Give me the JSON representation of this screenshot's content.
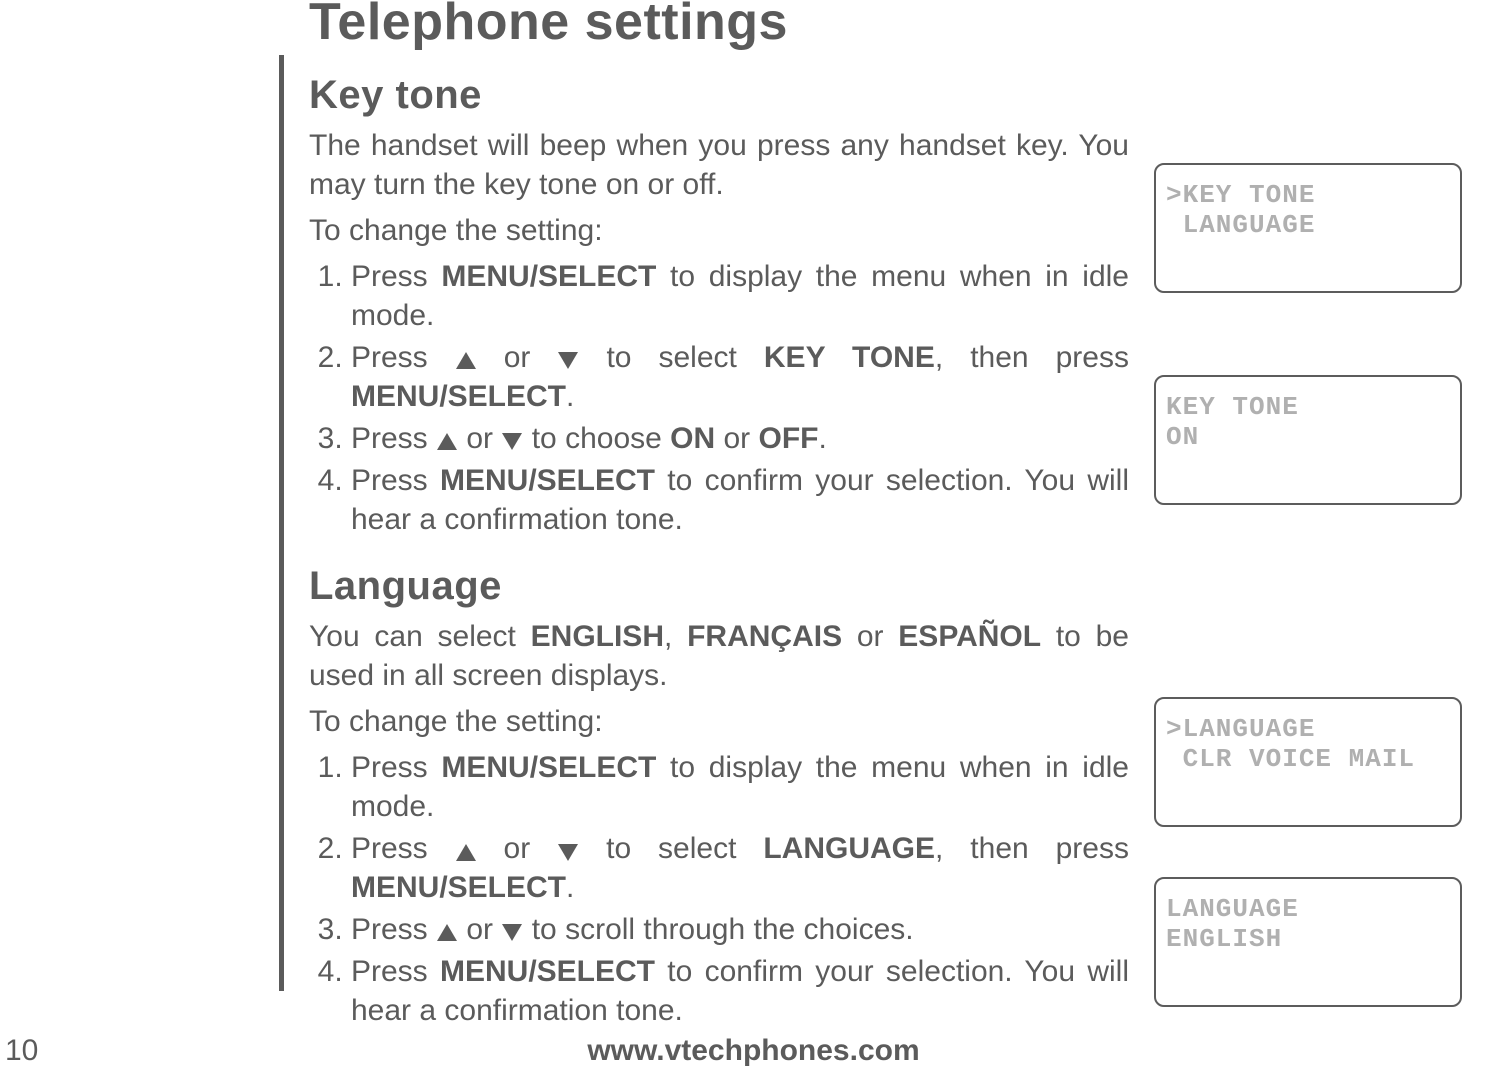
{
  "page": {
    "number": "10",
    "title": "Telephone settings",
    "footer_url": "www.vtechphones.com"
  },
  "section1": {
    "heading": "Key tone",
    "para1": "The handset will beep when you press any handset key. You may turn the key tone on or off.",
    "para2": "To change the setting:",
    "step1_pre": "Press ",
    "step1_bold": "MENU/SELECT",
    "step1_post": " to display the menu when in idle mode.",
    "step2_pre": "Press ",
    "step2_mid1": " or ",
    "step2_mid2": " to select ",
    "step2_bold1": "KEY TONE",
    "step2_mid3": ", then press ",
    "step2_bold2": "MENU/SELECT",
    "step2_post": ".",
    "step3_pre": "Press ",
    "step3_mid1": " or ",
    "step3_mid2": " to choose ",
    "step3_bold1": "ON",
    "step3_mid3": " or ",
    "step3_bold2": "OFF",
    "step3_post": ".",
    "step4_pre": "Press ",
    "step4_bold": "MENU/SELECT",
    "step4_post": " to confirm your selection. You will hear a confirmation tone."
  },
  "section2": {
    "heading": "Language",
    "para1_pre": "You can select ",
    "para1_b1": "ENGLISH",
    "para1_m1": ", ",
    "para1_b2": "FRANÇAIS",
    "para1_m2": " or ",
    "para1_b3": "ESPAÑOL",
    "para1_post": " to be used in all screen displays.",
    "para2": "To change the setting:",
    "step1_pre": "Press ",
    "step1_bold": "MENU/SELECT",
    "step1_post": " to display the menu when in idle mode.",
    "step2_pre": "Press ",
    "step2_mid1": " or ",
    "step2_mid2": " to select ",
    "step2_bold1": "LANGUAGE",
    "step2_mid3": ", then press ",
    "step2_bold2": "MENU/SELECT",
    "step2_post": ".",
    "step3_pre": "Press ",
    "step3_mid1": " or ",
    "step3_post": " to scroll through the choices.",
    "step4_pre": "Press ",
    "step4_bold": "MENU/SELECT",
    "step4_post": " to confirm your selection. You will hear a confirmation tone."
  },
  "screens": {
    "s1": ">KEY TONE\n LANGUAGE",
    "s2": "KEY TONE\nON",
    "s3": ">LANGUAGE\n CLR VOICE MAIL",
    "s4": "LANGUAGE\nENGLISH"
  }
}
